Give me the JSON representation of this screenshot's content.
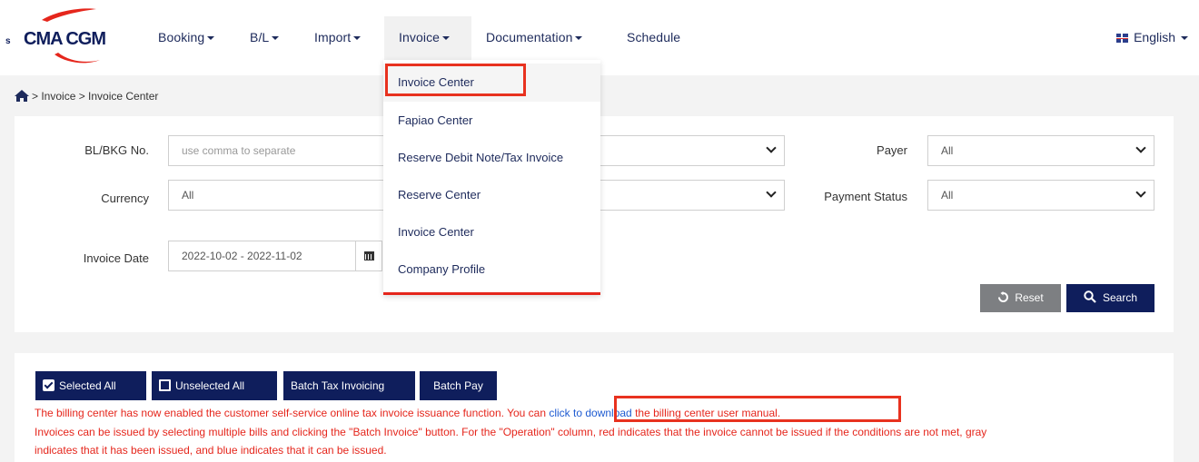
{
  "brand": {
    "name": "CMA CGM"
  },
  "nav": {
    "items": [
      {
        "label": "Booking",
        "has_menu": true
      },
      {
        "label": "B/L",
        "has_menu": true
      },
      {
        "label": "Import",
        "has_menu": true
      },
      {
        "label": "Invoice",
        "has_menu": true
      },
      {
        "label": "Documentation",
        "has_menu": true
      },
      {
        "label": "Schedule",
        "has_menu": false
      }
    ],
    "language": "English"
  },
  "breadcrumb": {
    "text": "> Invoice > Invoice Center"
  },
  "invoice_menu": {
    "items": [
      "Invoice Center",
      "Fapiao Center",
      "Reserve Debit Note/Tax Invoice",
      "Reserve Center",
      "Invoice Center",
      "Company Profile"
    ]
  },
  "filters": {
    "bl_label": "BL/BKG No.",
    "bl_placeholder": "use comma to separate",
    "currency_label": "Currency",
    "currency_value": "All",
    "invoice_date_label": "Invoice Date",
    "invoice_date_value": "2022-10-02 - 2022-11-02",
    "payer_label": "Payer",
    "payer_value": "All",
    "payment_status_label": "Payment Status",
    "payment_status_value": "All",
    "reset_label": "Reset",
    "search_label": "Search"
  },
  "actions": {
    "selected_all": "Selected All",
    "unselected_all": "Unselected All",
    "batch_tax": "Batch Tax Invoicing",
    "batch_pay": "Batch Pay"
  },
  "notice": {
    "line1_before": "The billing center has now enabled the customer self-service online tax invoice issuance function. You can ",
    "line1_link": "click to download",
    "line1_after": " the billing center user manual.",
    "line2": "Invoices can be issued by selecting multiple bills and clicking the \"Batch Invoice\" button. For the \"Operation\" column, red indicates that the invoice cannot be issued if the conditions are not met, gray",
    "line3": "indicates that it has been issued, and blue indicates that it can be issued."
  },
  "colors": {
    "navy": "#0f1e5c",
    "red": "#e5261c",
    "link": "#1e5bd1"
  }
}
